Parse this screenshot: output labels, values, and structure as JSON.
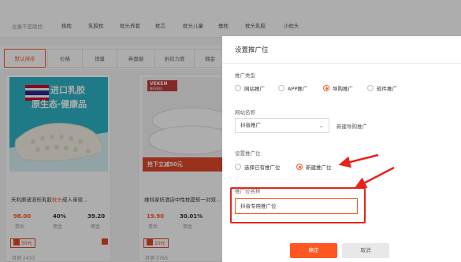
{
  "filters": {
    "label": "合量不是限优:",
    "items": [
      "桃枕",
      "乳胶枕",
      "枕头养套",
      "枕芯",
      "枕头儿童",
      "蚕枕",
      "枕头乳胶",
      "小枕头"
    ]
  },
  "sort_tabs": [
    "默认排序",
    "价格",
    "销量",
    "券面额",
    "折扣力度",
    "佣金"
  ],
  "products": [
    {
      "banner_line1": "进口乳胶",
      "banner_line2": "原生态·健康品",
      "title_prefix": "天利原波浪形乳胶",
      "title_highlight": "枕头",
      "title_suffix": "成人单双...",
      "price": "98.00",
      "rate": "40%",
      "commission": "39.20",
      "price_label": "券后",
      "rate_label": "佣金",
      "commission_label": "佣金",
      "coupon": "50元",
      "footer": "月销 2433"
    },
    {
      "brand": "VEKEN",
      "brand_sub": "维科家纺",
      "promo": "抢下立减50元",
      "title_prefix": "维科家纺酒店中性枕提软一对双...",
      "title_highlight": "",
      "title_suffix": "",
      "price": "19.90",
      "rate": "30.01%",
      "price_label": "券后",
      "rate_label": "佣金",
      "coupon": "10元",
      "footer": "月销 3765"
    }
  ],
  "modal": {
    "title": "设置推广位",
    "type_label": "推广类型",
    "type_options": [
      {
        "label": "网站推广",
        "checked": false
      },
      {
        "label": "APP推广",
        "checked": false
      },
      {
        "label": "导购推广",
        "checked": true
      },
      {
        "label": "软件推广",
        "checked": false
      }
    ],
    "site_label": "网站名称",
    "site_value": "抖音推广",
    "new_site_link": "新建导购推广",
    "position_label": "设置推广位",
    "position_options": [
      {
        "label": "选择已有推广位",
        "checked": false
      },
      {
        "label": "新建推广位",
        "checked": true
      }
    ],
    "name_label": "推广位名称",
    "name_value": "抖音专用推广位",
    "ok": "确定",
    "cancel": "取消"
  },
  "colors": {
    "accent": "#ff5722",
    "annotation": "#e8231a"
  }
}
